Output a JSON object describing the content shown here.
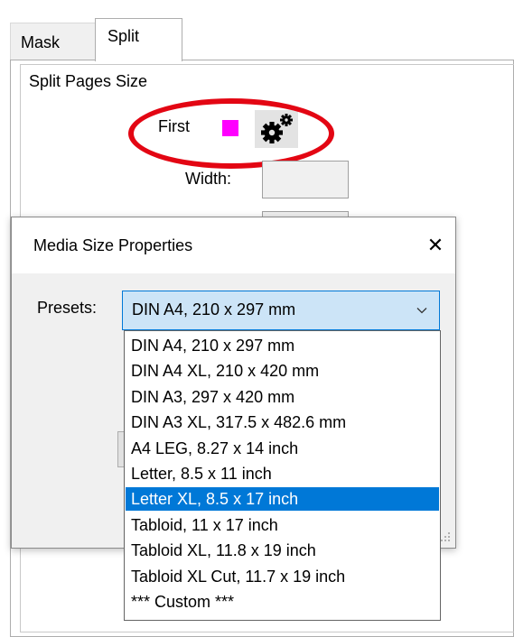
{
  "tabs": {
    "mask": "Mask",
    "split": "Split"
  },
  "split_panel": {
    "group_title": "Split Pages Size",
    "first_label": "First",
    "first_color": "#ff00ff",
    "settings_icon": "gears-icon",
    "width_label": "Width:",
    "width_value": "",
    "height_value": "",
    "highlight_color": "#e30613"
  },
  "dialog": {
    "title": "Media Size Properties",
    "close_glyph": "✕",
    "presets_label": "Presets:",
    "selected_value": "DIN A4, 210 x 297 mm",
    "options": [
      "DIN A4, 210 x 297 mm",
      "DIN A4 XL, 210 x 420 mm",
      "DIN A3, 297 x 420 mm",
      "DIN A3 XL, 317.5 x 482.6 mm",
      "A4 LEG, 8.27 x 14 inch",
      "Letter, 8.5 x 11 inch",
      "Letter XL, 8.5 x 17 inch",
      "Tabloid, 11 x 17 inch",
      "Tabloid XL, 11.8 x 19 inch",
      "Tabloid XL Cut, 11.7 x 19 inch",
      "*** Custom ***"
    ],
    "highlighted_option": "Letter XL, 8.5 x 17 inch",
    "accent_color": "#0078d7"
  }
}
